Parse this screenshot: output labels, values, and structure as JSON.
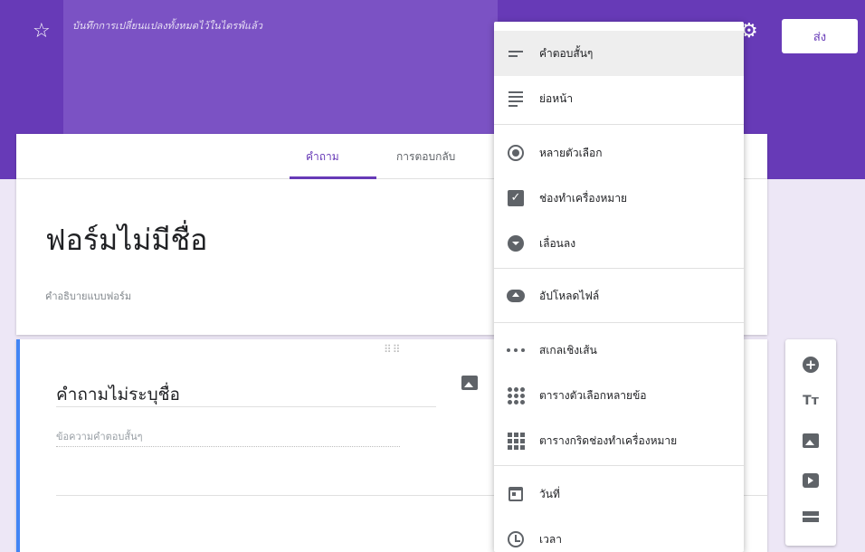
{
  "header": {
    "saved_status": "บันทึกการเปลี่ยนแปลงทั้งหมดไว้ในไดรฟ์แล้ว",
    "send_label": "ส่ง"
  },
  "tabs": {
    "questions": "คำถาม",
    "responses": "การตอบกลับ"
  },
  "form": {
    "title": "ฟอร์มไม่มีชื่อ",
    "description_placeholder": "คำอธิบายแบบฟอร์ม"
  },
  "question": {
    "title": "คำถามไม่ระบุชื่อ",
    "answer_placeholder": "ข้อความคำตอบสั้นๆ"
  },
  "question_type_menu": {
    "short_answer": "คำตอบสั้นๆ",
    "paragraph": "ย่อหน้า",
    "multiple_choice": "หลายตัวเลือก",
    "checkboxes": "ช่องทำเครื่องหมาย",
    "dropdown": "เลื่อนลง",
    "file_upload": "อัปโหลดไฟล์",
    "linear_scale": "สเกลเชิงเส้น",
    "multiple_choice_grid": "ตารางตัวเลือกหลายข้อ",
    "checkbox_grid": "ตารางกริดช่องทำเครื่องหมาย",
    "date": "วันที่",
    "time": "เวลา"
  },
  "colors": {
    "brand": "#673ab7",
    "accent": "#4285f4"
  }
}
